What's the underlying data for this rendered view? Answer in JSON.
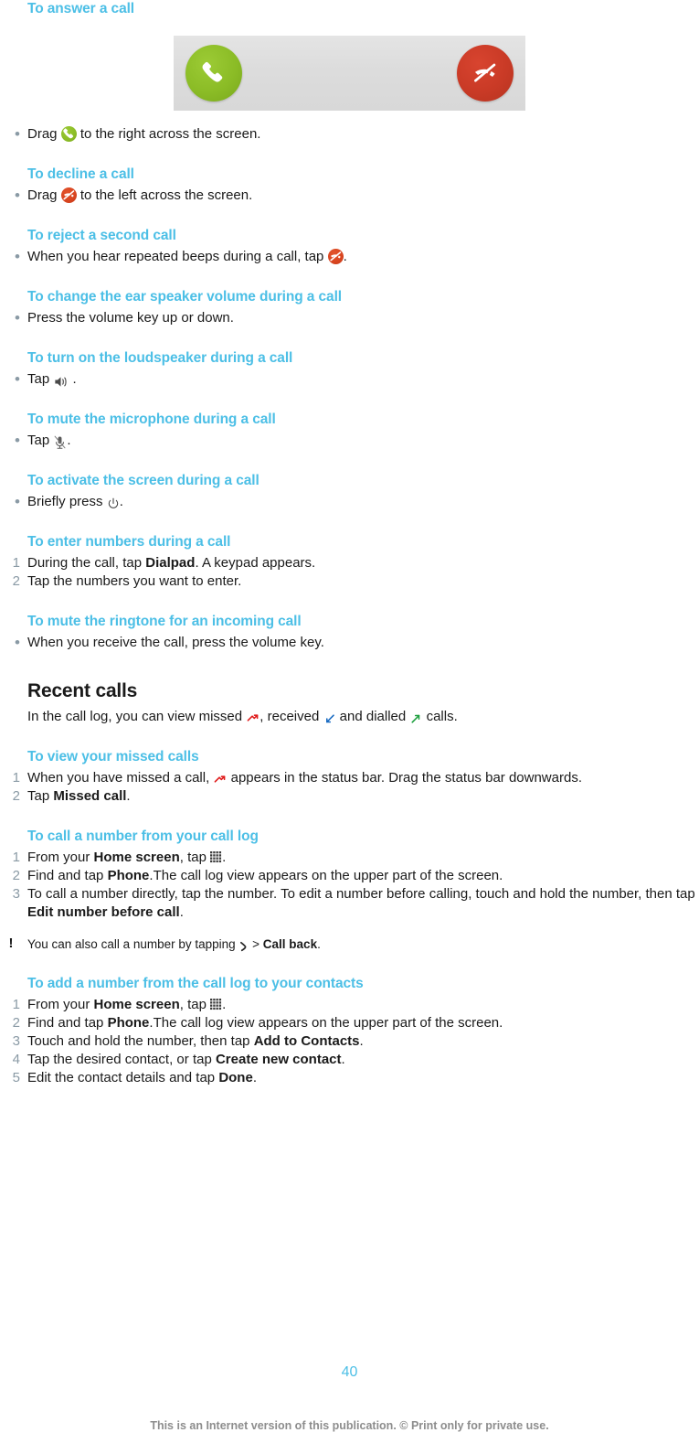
{
  "page": {
    "number": "40",
    "footer_note": "This is an Internet version of this publication. © Print only for private use.",
    "accent_color": "#4cbfe6",
    "marker_color": "#8a9aa5"
  },
  "figure": {
    "name": "incoming-call-screen",
    "answer_button_color": "#8bbc26",
    "decline_button_color": "#c93a26",
    "bar_color": "#dcdcdc"
  },
  "sections": [
    {
      "heading": "To answer a call",
      "steps": [
        {
          "marker": "•",
          "parts": [
            {
              "t": "text",
              "v": "Drag "
            },
            {
              "t": "icon",
              "v": "answer-call-icon"
            },
            {
              "t": "text",
              "v": " to the right across the screen."
            }
          ]
        }
      ]
    },
    {
      "heading": "To decline a call",
      "steps": [
        {
          "marker": "•",
          "parts": [
            {
              "t": "text",
              "v": "Drag "
            },
            {
              "t": "icon",
              "v": "decline-call-icon"
            },
            {
              "t": "text",
              "v": " to the left across the screen."
            }
          ]
        }
      ]
    },
    {
      "heading": "To reject a second call",
      "steps": [
        {
          "marker": "•",
          "parts": [
            {
              "t": "text",
              "v": "When you hear repeated beeps during a call, tap "
            },
            {
              "t": "icon",
              "v": "decline-call-icon"
            },
            {
              "t": "text",
              "v": "."
            }
          ]
        }
      ]
    },
    {
      "heading": "To change the ear speaker volume during a call",
      "steps": [
        {
          "marker": "•",
          "parts": [
            {
              "t": "text",
              "v": "Press the volume key up or down."
            }
          ]
        }
      ]
    },
    {
      "heading": "To turn on the loudspeaker during a call",
      "steps": [
        {
          "marker": "•",
          "parts": [
            {
              "t": "text",
              "v": "Tap "
            },
            {
              "t": "icon",
              "v": "loudspeaker-icon"
            },
            {
              "t": "text",
              "v": " ."
            }
          ]
        }
      ]
    },
    {
      "heading": "To mute the microphone during a call",
      "steps": [
        {
          "marker": "•",
          "parts": [
            {
              "t": "text",
              "v": "Tap "
            },
            {
              "t": "icon",
              "v": "microphone-mute-icon"
            },
            {
              "t": "text",
              "v": "."
            }
          ]
        }
      ]
    },
    {
      "heading": "To activate the screen during a call",
      "steps": [
        {
          "marker": "•",
          "parts": [
            {
              "t": "text",
              "v": "Briefly press "
            },
            {
              "t": "icon",
              "v": "power-icon"
            },
            {
              "t": "text",
              "v": "."
            }
          ]
        }
      ]
    },
    {
      "heading": "To enter numbers during a call",
      "steps": [
        {
          "marker": "1",
          "parts": [
            {
              "t": "text",
              "v": "During the call, tap "
            },
            {
              "t": "bold",
              "v": "Dialpad"
            },
            {
              "t": "text",
              "v": ". A keypad appears."
            }
          ]
        },
        {
          "marker": "2",
          "parts": [
            {
              "t": "text",
              "v": "Tap the numbers you want to enter."
            }
          ]
        }
      ]
    },
    {
      "heading": "To mute the ringtone for an incoming call",
      "steps": [
        {
          "marker": "•",
          "parts": [
            {
              "t": "text",
              "v": "When you receive the call, press the volume key."
            }
          ]
        }
      ]
    }
  ],
  "recent_calls": {
    "heading": "Recent calls",
    "intro_parts": [
      {
        "t": "text",
        "v": "In the call log, you can view missed "
      },
      {
        "t": "icon",
        "v": "missed-call-arrow-icon"
      },
      {
        "t": "text",
        "v": ", received "
      },
      {
        "t": "icon",
        "v": "received-call-arrow-icon"
      },
      {
        "t": "text",
        "v": " and dialled "
      },
      {
        "t": "icon",
        "v": "dialled-call-arrow-icon"
      },
      {
        "t": "text",
        "v": " calls."
      }
    ],
    "sections": [
      {
        "heading": "To view your missed calls",
        "steps": [
          {
            "marker": "1",
            "parts": [
              {
                "t": "text",
                "v": "When you have missed a call, "
              },
              {
                "t": "icon",
                "v": "missed-call-arrow-icon"
              },
              {
                "t": "text",
                "v": " appears in the status bar. Drag the status bar downwards."
              }
            ]
          },
          {
            "marker": "2",
            "parts": [
              {
                "t": "text",
                "v": "Tap "
              },
              {
                "t": "bold",
                "v": "Missed call"
              },
              {
                "t": "text",
                "v": "."
              }
            ]
          }
        ]
      },
      {
        "heading": "To call a number from your call log",
        "steps": [
          {
            "marker": "1",
            "parts": [
              {
                "t": "text",
                "v": "From your "
              },
              {
                "t": "bold",
                "v": "Home screen"
              },
              {
                "t": "text",
                "v": ", tap "
              },
              {
                "t": "icon",
                "v": "app-grid-icon"
              },
              {
                "t": "text",
                "v": "."
              }
            ]
          },
          {
            "marker": "2",
            "parts": [
              {
                "t": "text",
                "v": "Find and tap "
              },
              {
                "t": "bold",
                "v": "Phone"
              },
              {
                "t": "text",
                "v": ".The call log view appears on the upper part of the screen."
              }
            ]
          },
          {
            "marker": "3",
            "parts": [
              {
                "t": "text",
                "v": "To call a number directly, tap the number. To edit a number before calling, touch and hold the number, then tap "
              },
              {
                "t": "bold",
                "v": "Edit number before call"
              },
              {
                "t": "text",
                "v": "."
              }
            ]
          }
        ],
        "note": {
          "marker": "!",
          "parts": [
            {
              "t": "text",
              "v": "You can also call a number by tapping "
            },
            {
              "t": "icon",
              "v": "chevron-right-icon"
            },
            {
              "t": "text",
              "v": " > "
            },
            {
              "t": "bold",
              "v": "Call back"
            },
            {
              "t": "text",
              "v": "."
            }
          ]
        }
      },
      {
        "heading": "To add a number from the call log to your contacts",
        "steps": [
          {
            "marker": "1",
            "parts": [
              {
                "t": "text",
                "v": "From your "
              },
              {
                "t": "bold",
                "v": "Home screen"
              },
              {
                "t": "text",
                "v": ", tap "
              },
              {
                "t": "icon",
                "v": "app-grid-icon"
              },
              {
                "t": "text",
                "v": "."
              }
            ]
          },
          {
            "marker": "2",
            "parts": [
              {
                "t": "text",
                "v": "Find and tap "
              },
              {
                "t": "bold",
                "v": "Phone"
              },
              {
                "t": "text",
                "v": ".The call log view appears on the upper part of the screen."
              }
            ]
          },
          {
            "marker": "3",
            "parts": [
              {
                "t": "text",
                "v": "Touch and hold the number, then tap "
              },
              {
                "t": "bold",
                "v": "Add to Contacts"
              },
              {
                "t": "text",
                "v": "."
              }
            ]
          },
          {
            "marker": "4",
            "parts": [
              {
                "t": "text",
                "v": "Tap the desired contact, or tap "
              },
              {
                "t": "bold",
                "v": "Create new contact"
              },
              {
                "t": "text",
                "v": "."
              }
            ]
          },
          {
            "marker": "5",
            "parts": [
              {
                "t": "text",
                "v": "Edit the contact details and tap "
              },
              {
                "t": "bold",
                "v": "Done"
              },
              {
                "t": "text",
                "v": "."
              }
            ]
          }
        ]
      }
    ]
  }
}
